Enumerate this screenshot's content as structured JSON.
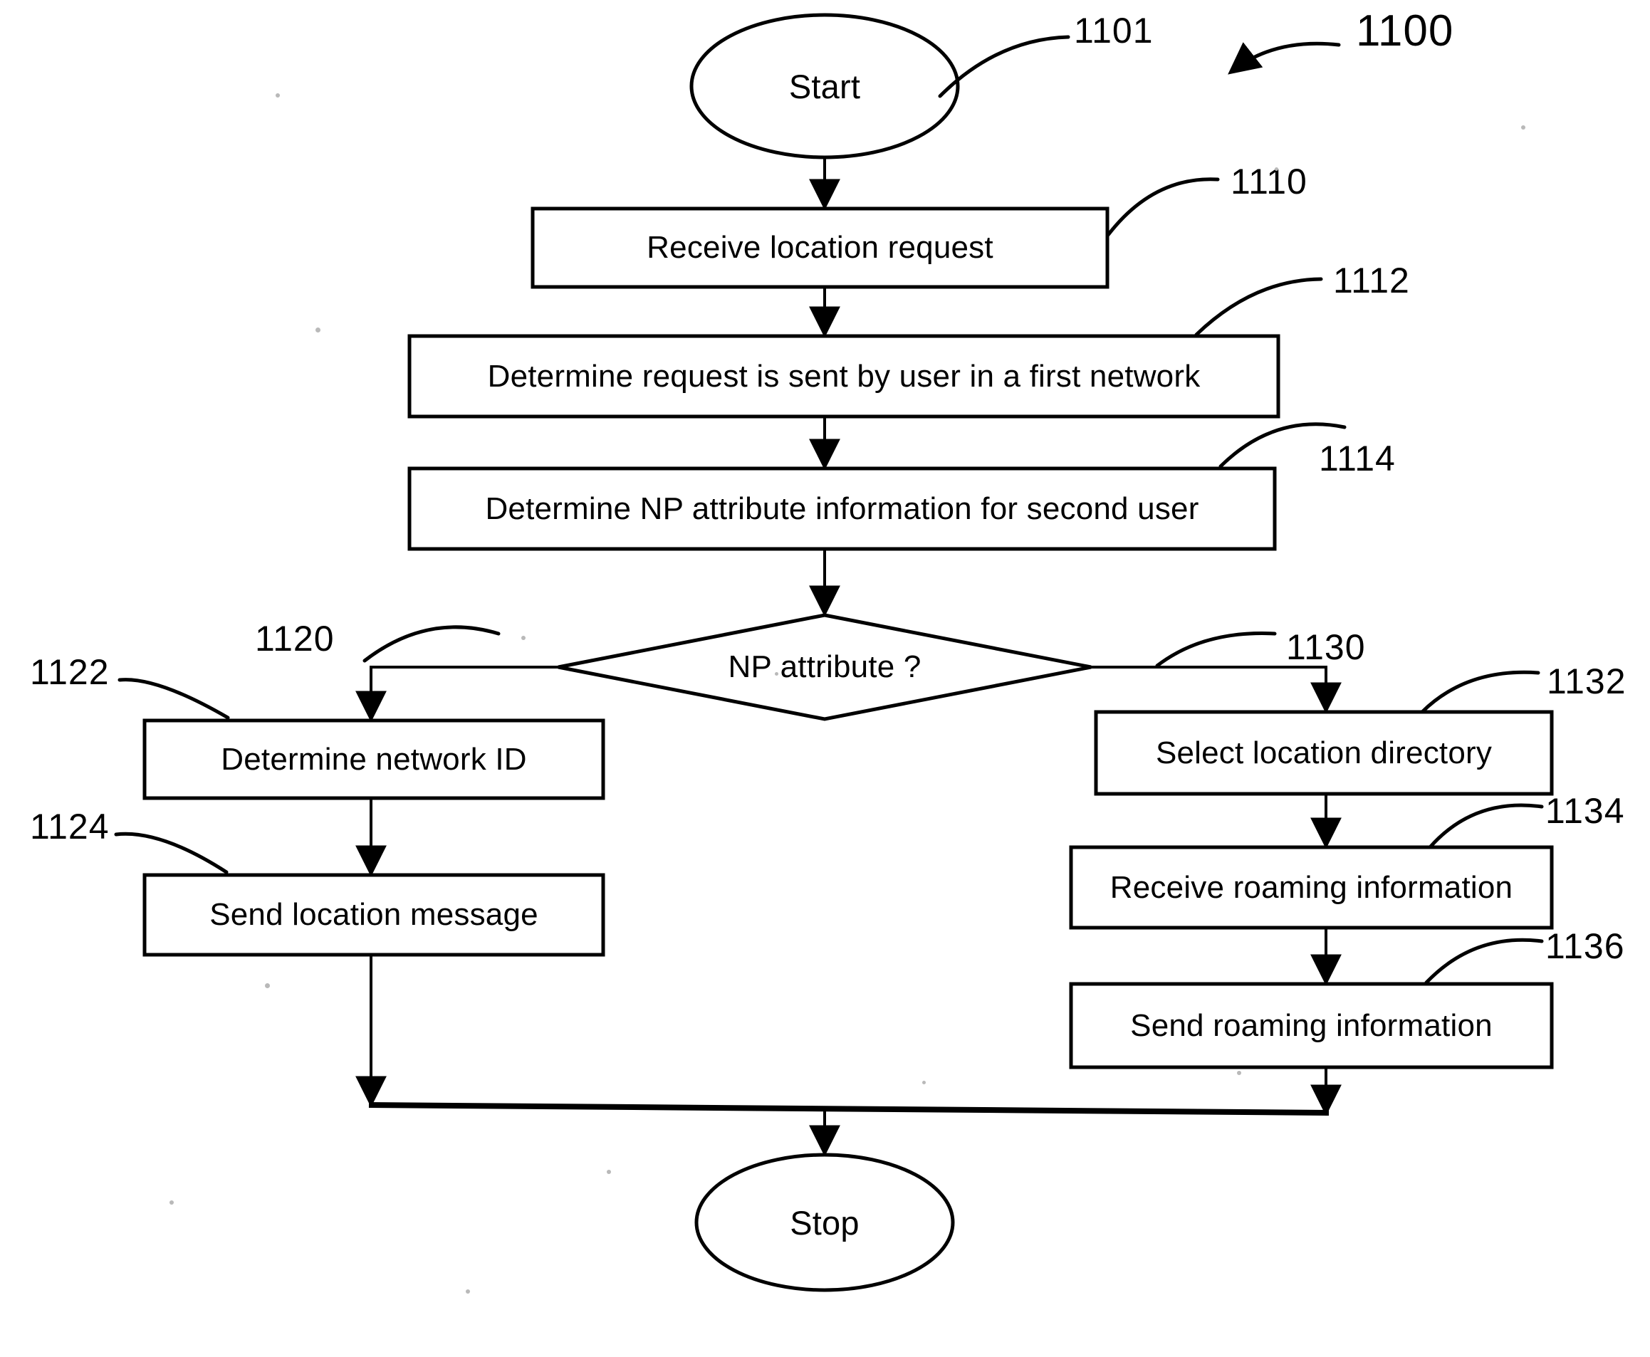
{
  "figure": {
    "number": "1100",
    "title": "Flowchart 1100 — location request handling with number portability (NP) attribute decision"
  },
  "nodes": {
    "start": {
      "label": "Start",
      "ref": "1101",
      "shape": "ellipse"
    },
    "receive_location_request": {
      "label": "Receive location request",
      "ref": "1110",
      "shape": "process"
    },
    "determine_first_network": {
      "label": "Determine request is sent by user in a first network",
      "ref": "1112",
      "shape": "process"
    },
    "determine_np_attribute": {
      "label": "Determine NP attribute information for second user",
      "ref": "1114",
      "shape": "process"
    },
    "np_attribute_decision": {
      "label": "NP attribute  ?",
      "ref": "1120",
      "shape": "decision"
    },
    "determine_network_id": {
      "label": "Determine network ID",
      "ref": "1122",
      "shape": "process"
    },
    "send_location_message": {
      "label": "Send location message",
      "ref": "1124",
      "shape": "process"
    },
    "select_location_directory": {
      "label": "Select location directory",
      "ref": "1132",
      "shape": "process"
    },
    "receive_roaming_information": {
      "label": "Receive roaming information",
      "ref": "1134",
      "shape": "process"
    },
    "send_roaming_information": {
      "label": "Send roaming information",
      "ref": "1136",
      "shape": "process"
    },
    "stop": {
      "label": "Stop",
      "shape": "ellipse"
    }
  },
  "branches": {
    "left_ref": "1120",
    "right_ref": "1130"
  },
  "colors": {
    "stroke": "#000000",
    "background": "#ffffff",
    "text": "#000000"
  }
}
